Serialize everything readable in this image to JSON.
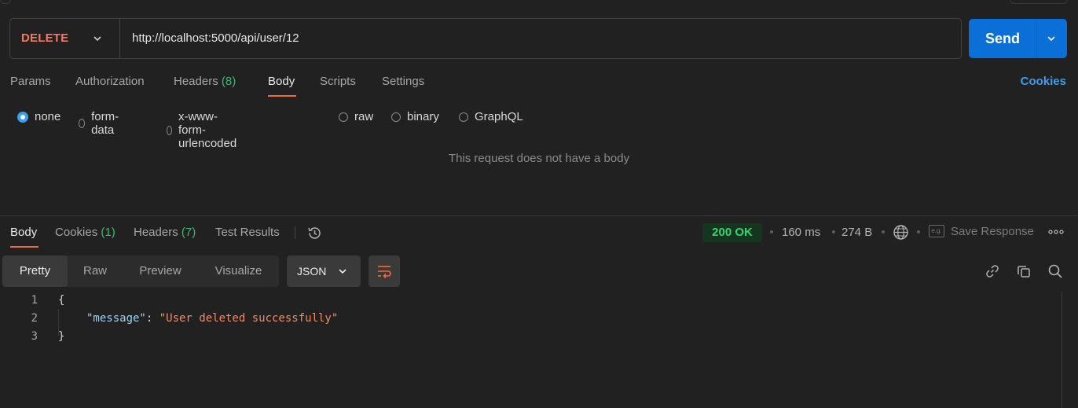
{
  "request": {
    "method": "DELETE",
    "url": "http://localhost:5000/api/user/12",
    "send_label": "Send"
  },
  "request_tabs": [
    {
      "label": "Params"
    },
    {
      "label": "Authorization"
    },
    {
      "label": "Headers",
      "count": "(8)"
    },
    {
      "label": "Body",
      "active": true
    },
    {
      "label": "Scripts"
    },
    {
      "label": "Settings"
    }
  ],
  "cookies_link": "Cookies",
  "body_types": [
    {
      "label": "none",
      "selected": true
    },
    {
      "label": "form-data"
    },
    {
      "label": "x-www-form-urlencoded"
    },
    {
      "label": "raw"
    },
    {
      "label": "binary"
    },
    {
      "label": "GraphQL"
    }
  ],
  "empty_body_message": "This request does not have a body",
  "response_tabs": [
    {
      "label": "Body",
      "active": true
    },
    {
      "label": "Cookies",
      "count": "(1)"
    },
    {
      "label": "Headers",
      "count": "(7)"
    },
    {
      "label": "Test Results"
    }
  ],
  "response_meta": {
    "status": "200 OK",
    "time": "160 ms",
    "size": "274 B",
    "save_response": "Save Response",
    "save_icon_text": "e.g."
  },
  "view_modes": [
    "Pretty",
    "Raw",
    "Preview",
    "Visualize"
  ],
  "format": "JSON",
  "code": {
    "line_numbers": [
      "1",
      "2",
      "3"
    ],
    "open_brace": "{",
    "key": "\"message\"",
    "colon": ": ",
    "value": "\"User deleted successfully\"",
    "close_brace": "}"
  },
  "colors": {
    "method": "#f27a5e",
    "send": "#0a6fd6",
    "accent_underline": "#f26b3a",
    "status_ok": "#3fcf74",
    "link": "#3d9df2"
  },
  "icons": [
    "chevron-down-icon",
    "history-icon",
    "globe-icon",
    "save-icon",
    "more-icon",
    "wrap-icon",
    "link-icon",
    "copy-icon",
    "search-icon"
  ]
}
